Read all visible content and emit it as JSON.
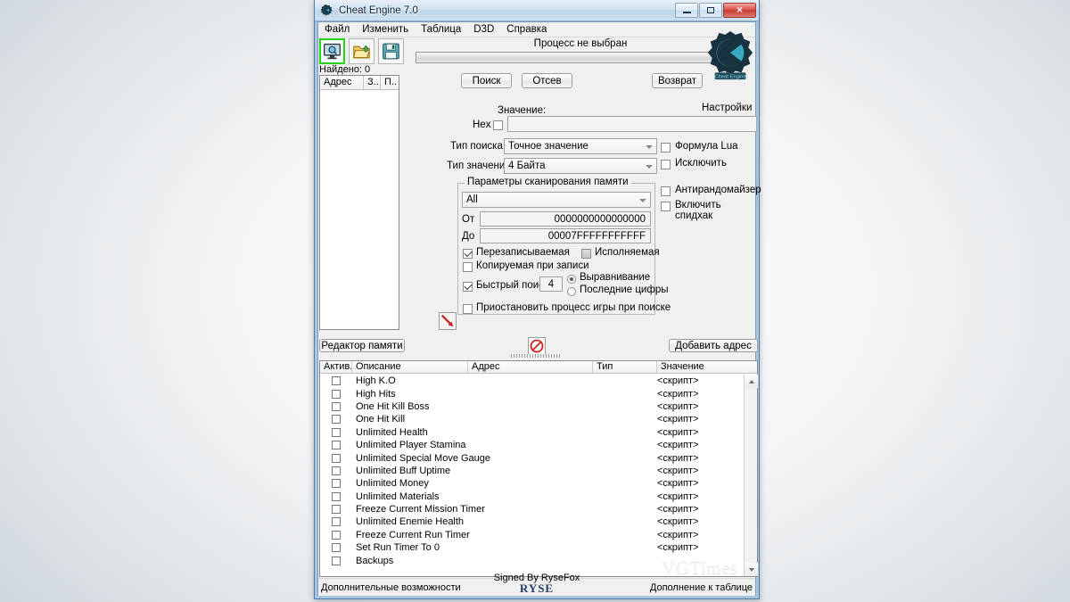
{
  "window": {
    "title": "Cheat Engine 7.0",
    "logo_icon": "cheat-engine-gear-icon",
    "controls": {
      "minimize": "minimize-icon",
      "maximize": "maximize-icon",
      "close": "✕"
    }
  },
  "menu": {
    "items": [
      {
        "label": "Файл"
      },
      {
        "label": "Изменить"
      },
      {
        "label": "Таблица"
      },
      {
        "label": "D3D"
      },
      {
        "label": "Справка"
      }
    ]
  },
  "toolbar": {
    "buttons": [
      {
        "name": "open-process-button",
        "icon": "monitor-magnifier-icon",
        "active": true
      },
      {
        "name": "open-table-button",
        "icon": "open-folder-icon",
        "active": false
      },
      {
        "name": "save-table-button",
        "icon": "floppy-save-icon",
        "active": false
      }
    ],
    "process_label": "Процесс не выбран"
  },
  "scan": {
    "found_label": "Найдено: 0",
    "address_columns": [
      "Адрес",
      "З..",
      "П.."
    ],
    "buttons": {
      "first_scan": "Поиск",
      "next_scan": "Отсев",
      "undo_scan": "Возврат"
    },
    "settings_label": "Настройки",
    "value_caption": "Значение:",
    "hex_label": "Hex",
    "hex_checked": false,
    "value_input": "",
    "scan_type_label": "Тип поиска",
    "scan_type_value": "Точное значение",
    "value_type_label": "Тип значения",
    "value_type_value": "4 Байта",
    "lua_formula_label": "Формула Lua",
    "lua_formula_checked": false,
    "not_label": "Исключить",
    "not_checked": false
  },
  "memory": {
    "group_caption": "Параметры сканирования памяти",
    "region_value": "All",
    "from_label": "От",
    "from_value": "0000000000000000",
    "to_label": "До",
    "to_value": "00007FFFFFFFFFFF",
    "writable_label": "Перезаписываемая",
    "writable_checked": true,
    "executable_label": "Исполняемая",
    "executable_checked": false,
    "copyonwrite_label": "Копируемая при записи",
    "copyonwrite_checked": false,
    "fastscan_label": "Быстрый поиск",
    "fastscan_checked": true,
    "fastscan_value": "4",
    "alignment_label": "Выравнивание",
    "alignment_selected": true,
    "lastdigits_label": "Последние цифры",
    "lastdigits_selected": false,
    "pause_label": "Приостановить процесс игры при поиске",
    "pause_checked": false,
    "anti_random_label": "Антирандомайзер",
    "anti_random_checked": false,
    "speedhack_label": "Включить спидхак",
    "speedhack_checked": false,
    "drag_icon": "red-arrow-pointer-icon"
  },
  "midbar": {
    "memory_view_label": "Редактор памяти",
    "add_address_label": "Добавить адрес",
    "no_icon": "red-prohibition-icon"
  },
  "table": {
    "columns": [
      "Актив.",
      "Описание",
      "Адрес",
      "Тип",
      "Значение"
    ],
    "rows": [
      {
        "active": false,
        "description": "High K.O",
        "address": "",
        "type": "",
        "value": "<скрипт>"
      },
      {
        "active": false,
        "description": "High Hits",
        "address": "",
        "type": "",
        "value": "<скрипт>"
      },
      {
        "active": false,
        "description": "One Hit Kill Boss",
        "address": "",
        "type": "",
        "value": "<скрипт>"
      },
      {
        "active": false,
        "description": "One Hit Kill",
        "address": "",
        "type": "",
        "value": "<скрипт>"
      },
      {
        "active": false,
        "description": "Unlimited Health",
        "address": "",
        "type": "",
        "value": "<скрипт>"
      },
      {
        "active": false,
        "description": "Unlimited Player Stamina",
        "address": "",
        "type": "",
        "value": "<скрипт>"
      },
      {
        "active": false,
        "description": "Unlimited Special Move Gauge",
        "address": "",
        "type": "",
        "value": "<скрипт>"
      },
      {
        "active": false,
        "description": "Unlimited Buff Uptime",
        "address": "",
        "type": "",
        "value": "<скрипт>"
      },
      {
        "active": false,
        "description": "Unlimited Money",
        "address": "",
        "type": "",
        "value": "<скрипт>"
      },
      {
        "active": false,
        "description": "Unlimited Materials",
        "address": "",
        "type": "",
        "value": "<скрипт>"
      },
      {
        "active": false,
        "description": "Freeze Current Mission Timer",
        "address": "",
        "type": "",
        "value": "<скрипт>"
      },
      {
        "active": false,
        "description": "Unlimited Enemie Health",
        "address": "",
        "type": "",
        "value": "<скрипт>"
      },
      {
        "active": false,
        "description": "Freeze Current Run Timer",
        "address": "",
        "type": "",
        "value": "<скрипт>"
      },
      {
        "active": false,
        "description": "Set Run Timer To 0",
        "address": "",
        "type": "",
        "value": "<скрипт>"
      },
      {
        "active": false,
        "description": "Backups",
        "address": "",
        "type": "",
        "value": ""
      }
    ]
  },
  "status": {
    "left": "Дополнительные возможности",
    "signed_by": "Signed By RyseFox",
    "signed_logo": "RYSE",
    "right": "Дополнение к таблице"
  },
  "watermark": "VGTimes",
  "colors": {
    "accent_green": "#2ad11b",
    "close_red": "#c23a33",
    "title_blue": "#bcd6ea",
    "logo_teal": "#2f9fb5"
  }
}
